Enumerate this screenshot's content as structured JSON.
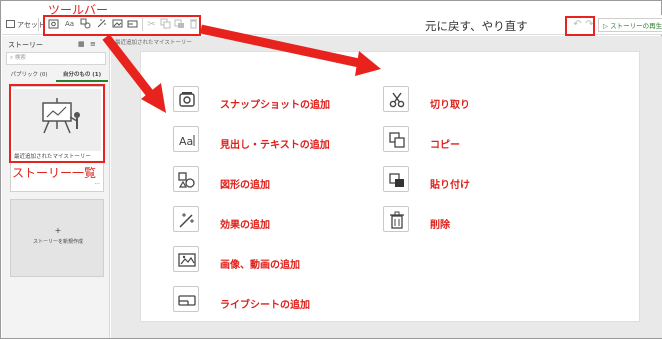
{
  "app": {
    "asset_label": "アセット",
    "play_label": "ストーリーの再生"
  },
  "sidebar": {
    "title": "ストーリー",
    "search_placeholder": "検索",
    "tabs": [
      "パブリック (0)",
      "自分のもの (1)"
    ],
    "story_title": "最近追加されたマイストーリー",
    "story_more": "···",
    "new_story_plus": "+",
    "new_story_label": "ストーリーを新規作成"
  },
  "main": {
    "breadcrumb": "最近追加されたマイストーリー"
  },
  "tools": {
    "left": [
      "スナップショットの追加",
      "見出し・テキストの追加",
      "図形の追加",
      "効果の追加",
      "画像、動画の追加",
      "ライブシートの追加"
    ],
    "right": [
      "切り取り",
      "コピー",
      "貼り付け",
      "削除"
    ]
  },
  "annotations": {
    "toolbar": "ツールバー",
    "undo_redo": "元に戻す、やり直す",
    "story_list": "ストーリー一覧"
  },
  "colors": {
    "annotation_red": "#e0201b",
    "accent_green": "#2e7d32"
  }
}
